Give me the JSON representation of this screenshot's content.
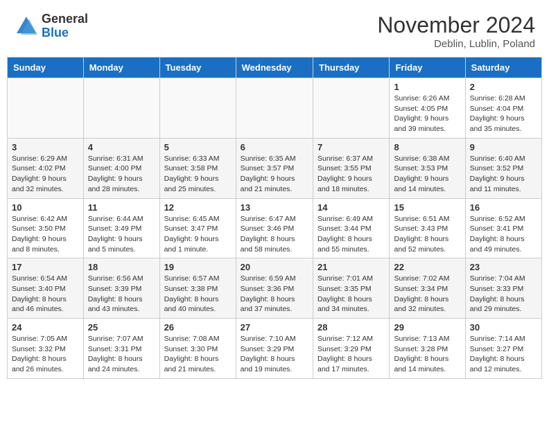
{
  "header": {
    "logo_general": "General",
    "logo_blue": "Blue",
    "title": "November 2024",
    "subtitle": "Deblin, Lublin, Poland"
  },
  "columns": [
    "Sunday",
    "Monday",
    "Tuesday",
    "Wednesday",
    "Thursday",
    "Friday",
    "Saturday"
  ],
  "weeks": [
    [
      {
        "day": "",
        "empty": true
      },
      {
        "day": "",
        "empty": true
      },
      {
        "day": "",
        "empty": true
      },
      {
        "day": "",
        "empty": true
      },
      {
        "day": "",
        "empty": true
      },
      {
        "day": "1",
        "info": "Sunrise: 6:26 AM\nSunset: 4:05 PM\nDaylight: 9 hours and 39 minutes."
      },
      {
        "day": "2",
        "info": "Sunrise: 6:28 AM\nSunset: 4:04 PM\nDaylight: 9 hours and 35 minutes."
      }
    ],
    [
      {
        "day": "3",
        "info": "Sunrise: 6:29 AM\nSunset: 4:02 PM\nDaylight: 9 hours and 32 minutes."
      },
      {
        "day": "4",
        "info": "Sunrise: 6:31 AM\nSunset: 4:00 PM\nDaylight: 9 hours and 28 minutes."
      },
      {
        "day": "5",
        "info": "Sunrise: 6:33 AM\nSunset: 3:58 PM\nDaylight: 9 hours and 25 minutes."
      },
      {
        "day": "6",
        "info": "Sunrise: 6:35 AM\nSunset: 3:57 PM\nDaylight: 9 hours and 21 minutes."
      },
      {
        "day": "7",
        "info": "Sunrise: 6:37 AM\nSunset: 3:55 PM\nDaylight: 9 hours and 18 minutes."
      },
      {
        "day": "8",
        "info": "Sunrise: 6:38 AM\nSunset: 3:53 PM\nDaylight: 9 hours and 14 minutes."
      },
      {
        "day": "9",
        "info": "Sunrise: 6:40 AM\nSunset: 3:52 PM\nDaylight: 9 hours and 11 minutes."
      }
    ],
    [
      {
        "day": "10",
        "info": "Sunrise: 6:42 AM\nSunset: 3:50 PM\nDaylight: 9 hours and 8 minutes."
      },
      {
        "day": "11",
        "info": "Sunrise: 6:44 AM\nSunset: 3:49 PM\nDaylight: 9 hours and 5 minutes."
      },
      {
        "day": "12",
        "info": "Sunrise: 6:45 AM\nSunset: 3:47 PM\nDaylight: 9 hours and 1 minute."
      },
      {
        "day": "13",
        "info": "Sunrise: 6:47 AM\nSunset: 3:46 PM\nDaylight: 8 hours and 58 minutes."
      },
      {
        "day": "14",
        "info": "Sunrise: 6:49 AM\nSunset: 3:44 PM\nDaylight: 8 hours and 55 minutes."
      },
      {
        "day": "15",
        "info": "Sunrise: 6:51 AM\nSunset: 3:43 PM\nDaylight: 8 hours and 52 minutes."
      },
      {
        "day": "16",
        "info": "Sunrise: 6:52 AM\nSunset: 3:41 PM\nDaylight: 8 hours and 49 minutes."
      }
    ],
    [
      {
        "day": "17",
        "info": "Sunrise: 6:54 AM\nSunset: 3:40 PM\nDaylight: 8 hours and 46 minutes."
      },
      {
        "day": "18",
        "info": "Sunrise: 6:56 AM\nSunset: 3:39 PM\nDaylight: 8 hours and 43 minutes."
      },
      {
        "day": "19",
        "info": "Sunrise: 6:57 AM\nSunset: 3:38 PM\nDaylight: 8 hours and 40 minutes."
      },
      {
        "day": "20",
        "info": "Sunrise: 6:59 AM\nSunset: 3:36 PM\nDaylight: 8 hours and 37 minutes."
      },
      {
        "day": "21",
        "info": "Sunrise: 7:01 AM\nSunset: 3:35 PM\nDaylight: 8 hours and 34 minutes."
      },
      {
        "day": "22",
        "info": "Sunrise: 7:02 AM\nSunset: 3:34 PM\nDaylight: 8 hours and 32 minutes."
      },
      {
        "day": "23",
        "info": "Sunrise: 7:04 AM\nSunset: 3:33 PM\nDaylight: 8 hours and 29 minutes."
      }
    ],
    [
      {
        "day": "24",
        "info": "Sunrise: 7:05 AM\nSunset: 3:32 PM\nDaylight: 8 hours and 26 minutes."
      },
      {
        "day": "25",
        "info": "Sunrise: 7:07 AM\nSunset: 3:31 PM\nDaylight: 8 hours and 24 minutes."
      },
      {
        "day": "26",
        "info": "Sunrise: 7:08 AM\nSunset: 3:30 PM\nDaylight: 8 hours and 21 minutes."
      },
      {
        "day": "27",
        "info": "Sunrise: 7:10 AM\nSunset: 3:29 PM\nDaylight: 8 hours and 19 minutes."
      },
      {
        "day": "28",
        "info": "Sunrise: 7:12 AM\nSunset: 3:29 PM\nDaylight: 8 hours and 17 minutes."
      },
      {
        "day": "29",
        "info": "Sunrise: 7:13 AM\nSunset: 3:28 PM\nDaylight: 8 hours and 14 minutes."
      },
      {
        "day": "30",
        "info": "Sunrise: 7:14 AM\nSunset: 3:27 PM\nDaylight: 8 hours and 12 minutes."
      }
    ]
  ]
}
